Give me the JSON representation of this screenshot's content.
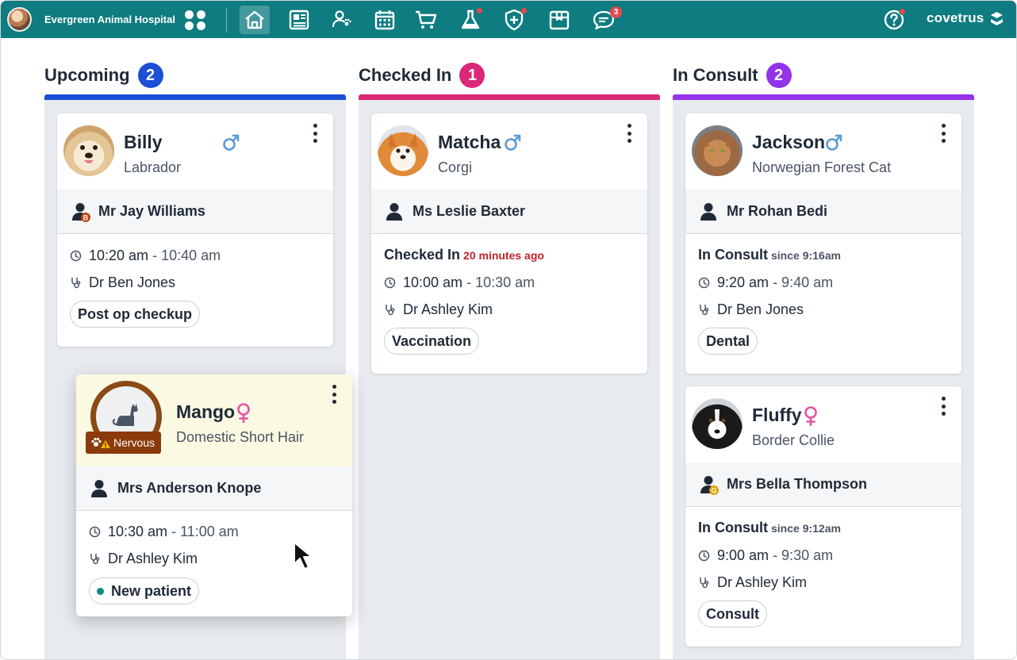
{
  "app": {
    "clinic_name": "Evergreen Animal Hospital",
    "brand": "covetrus",
    "nav_icons": [
      "home-icon",
      "dashboard-icon",
      "clients-patients-icon",
      "calendar-icon",
      "cart-icon",
      "lab-flask-icon",
      "health-shield-icon",
      "inventory-box-icon",
      "messages-icon"
    ],
    "messages_badge": "3",
    "help_icon": "help-icon",
    "accent_color": "#0e7c81",
    "alert_color": "#e5484d"
  },
  "columns": [
    {
      "title": "Upcoming",
      "count": "2",
      "color": "#1a4fd6",
      "cards": [
        {
          "pet_name": "Billy",
          "sex": "male",
          "breed": "Labrador",
          "owner": "Mr Jay Williams",
          "owner_badge": "B",
          "time_start": "10:20 am",
          "time_end": "- 10:40 am",
          "vet": "Dr Ben Jones",
          "tag": "Post op checkup"
        },
        {
          "pet_name": "Mango",
          "sex": "female",
          "breed": "Domestic Short Hair",
          "alert": "Nervous",
          "owner": "Mrs Anderson Knope",
          "time_start": "10:30 am",
          "time_end": "- 11:00 am",
          "vet": "Dr Ashley Kim",
          "tag": "New patient"
        }
      ]
    },
    {
      "title": "Checked In",
      "count": "1",
      "color": "#db2777",
      "cards": [
        {
          "pet_name": "Matcha",
          "sex": "male",
          "breed": "Corgi",
          "owner": "Ms Leslie Baxter",
          "status": "Checked In",
          "status_detail": "20 minutes ago",
          "time_start": "10:00 am",
          "time_end": "- 10:30 am",
          "vet": "Dr Ashley Kim",
          "tag": "Vaccination"
        }
      ]
    },
    {
      "title": "In Consult",
      "count": "2",
      "color": "#9333ea",
      "cards": [
        {
          "pet_name": "Jackson",
          "sex": "male",
          "breed": "Norwegian Forest Cat",
          "owner": "Mr Rohan Bedi",
          "status": "In Consult",
          "status_detail": "since 9:16am",
          "time_start": "9:20 am",
          "time_end": "- 9:40 am",
          "vet": "Dr Ben Jones",
          "tag": "Dental"
        },
        {
          "pet_name": "Fluffy",
          "sex": "female",
          "breed": "Border Collie",
          "owner": "Mrs Bella Thompson",
          "owner_badge": "G",
          "status": "In Consult",
          "status_detail": "since 9:12am",
          "time_start": "9:00 am",
          "time_end": "- 9:30 am",
          "vet": "Dr Ashley Kim",
          "tag": "Consult"
        }
      ]
    }
  ]
}
